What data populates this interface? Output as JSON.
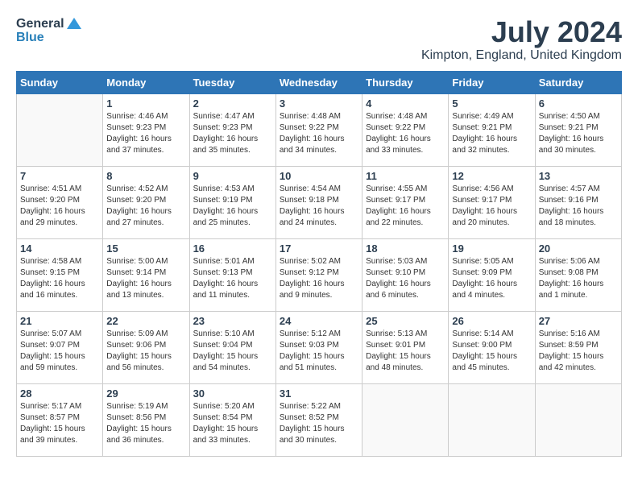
{
  "header": {
    "logo_line1": "General",
    "logo_line2": "Blue",
    "month_title": "July 2024",
    "location": "Kimpton, England, United Kingdom"
  },
  "days_of_week": [
    "Sunday",
    "Monday",
    "Tuesday",
    "Wednesday",
    "Thursday",
    "Friday",
    "Saturday"
  ],
  "weeks": [
    [
      {
        "day": "",
        "info": ""
      },
      {
        "day": "1",
        "info": "Sunrise: 4:46 AM\nSunset: 9:23 PM\nDaylight: 16 hours\nand 37 minutes."
      },
      {
        "day": "2",
        "info": "Sunrise: 4:47 AM\nSunset: 9:23 PM\nDaylight: 16 hours\nand 35 minutes."
      },
      {
        "day": "3",
        "info": "Sunrise: 4:48 AM\nSunset: 9:22 PM\nDaylight: 16 hours\nand 34 minutes."
      },
      {
        "day": "4",
        "info": "Sunrise: 4:48 AM\nSunset: 9:22 PM\nDaylight: 16 hours\nand 33 minutes."
      },
      {
        "day": "5",
        "info": "Sunrise: 4:49 AM\nSunset: 9:21 PM\nDaylight: 16 hours\nand 32 minutes."
      },
      {
        "day": "6",
        "info": "Sunrise: 4:50 AM\nSunset: 9:21 PM\nDaylight: 16 hours\nand 30 minutes."
      }
    ],
    [
      {
        "day": "7",
        "info": "Sunrise: 4:51 AM\nSunset: 9:20 PM\nDaylight: 16 hours\nand 29 minutes."
      },
      {
        "day": "8",
        "info": "Sunrise: 4:52 AM\nSunset: 9:20 PM\nDaylight: 16 hours\nand 27 minutes."
      },
      {
        "day": "9",
        "info": "Sunrise: 4:53 AM\nSunset: 9:19 PM\nDaylight: 16 hours\nand 25 minutes."
      },
      {
        "day": "10",
        "info": "Sunrise: 4:54 AM\nSunset: 9:18 PM\nDaylight: 16 hours\nand 24 minutes."
      },
      {
        "day": "11",
        "info": "Sunrise: 4:55 AM\nSunset: 9:17 PM\nDaylight: 16 hours\nand 22 minutes."
      },
      {
        "day": "12",
        "info": "Sunrise: 4:56 AM\nSunset: 9:17 PM\nDaylight: 16 hours\nand 20 minutes."
      },
      {
        "day": "13",
        "info": "Sunrise: 4:57 AM\nSunset: 9:16 PM\nDaylight: 16 hours\nand 18 minutes."
      }
    ],
    [
      {
        "day": "14",
        "info": "Sunrise: 4:58 AM\nSunset: 9:15 PM\nDaylight: 16 hours\nand 16 minutes."
      },
      {
        "day": "15",
        "info": "Sunrise: 5:00 AM\nSunset: 9:14 PM\nDaylight: 16 hours\nand 13 minutes."
      },
      {
        "day": "16",
        "info": "Sunrise: 5:01 AM\nSunset: 9:13 PM\nDaylight: 16 hours\nand 11 minutes."
      },
      {
        "day": "17",
        "info": "Sunrise: 5:02 AM\nSunset: 9:12 PM\nDaylight: 16 hours\nand 9 minutes."
      },
      {
        "day": "18",
        "info": "Sunrise: 5:03 AM\nSunset: 9:10 PM\nDaylight: 16 hours\nand 6 minutes."
      },
      {
        "day": "19",
        "info": "Sunrise: 5:05 AM\nSunset: 9:09 PM\nDaylight: 16 hours\nand 4 minutes."
      },
      {
        "day": "20",
        "info": "Sunrise: 5:06 AM\nSunset: 9:08 PM\nDaylight: 16 hours\nand 1 minute."
      }
    ],
    [
      {
        "day": "21",
        "info": "Sunrise: 5:07 AM\nSunset: 9:07 PM\nDaylight: 15 hours\nand 59 minutes."
      },
      {
        "day": "22",
        "info": "Sunrise: 5:09 AM\nSunset: 9:06 PM\nDaylight: 15 hours\nand 56 minutes."
      },
      {
        "day": "23",
        "info": "Sunrise: 5:10 AM\nSunset: 9:04 PM\nDaylight: 15 hours\nand 54 minutes."
      },
      {
        "day": "24",
        "info": "Sunrise: 5:12 AM\nSunset: 9:03 PM\nDaylight: 15 hours\nand 51 minutes."
      },
      {
        "day": "25",
        "info": "Sunrise: 5:13 AM\nSunset: 9:01 PM\nDaylight: 15 hours\nand 48 minutes."
      },
      {
        "day": "26",
        "info": "Sunrise: 5:14 AM\nSunset: 9:00 PM\nDaylight: 15 hours\nand 45 minutes."
      },
      {
        "day": "27",
        "info": "Sunrise: 5:16 AM\nSunset: 8:59 PM\nDaylight: 15 hours\nand 42 minutes."
      }
    ],
    [
      {
        "day": "28",
        "info": "Sunrise: 5:17 AM\nSunset: 8:57 PM\nDaylight: 15 hours\nand 39 minutes."
      },
      {
        "day": "29",
        "info": "Sunrise: 5:19 AM\nSunset: 8:56 PM\nDaylight: 15 hours\nand 36 minutes."
      },
      {
        "day": "30",
        "info": "Sunrise: 5:20 AM\nSunset: 8:54 PM\nDaylight: 15 hours\nand 33 minutes."
      },
      {
        "day": "31",
        "info": "Sunrise: 5:22 AM\nSunset: 8:52 PM\nDaylight: 15 hours\nand 30 minutes."
      },
      {
        "day": "",
        "info": ""
      },
      {
        "day": "",
        "info": ""
      },
      {
        "day": "",
        "info": ""
      }
    ]
  ]
}
